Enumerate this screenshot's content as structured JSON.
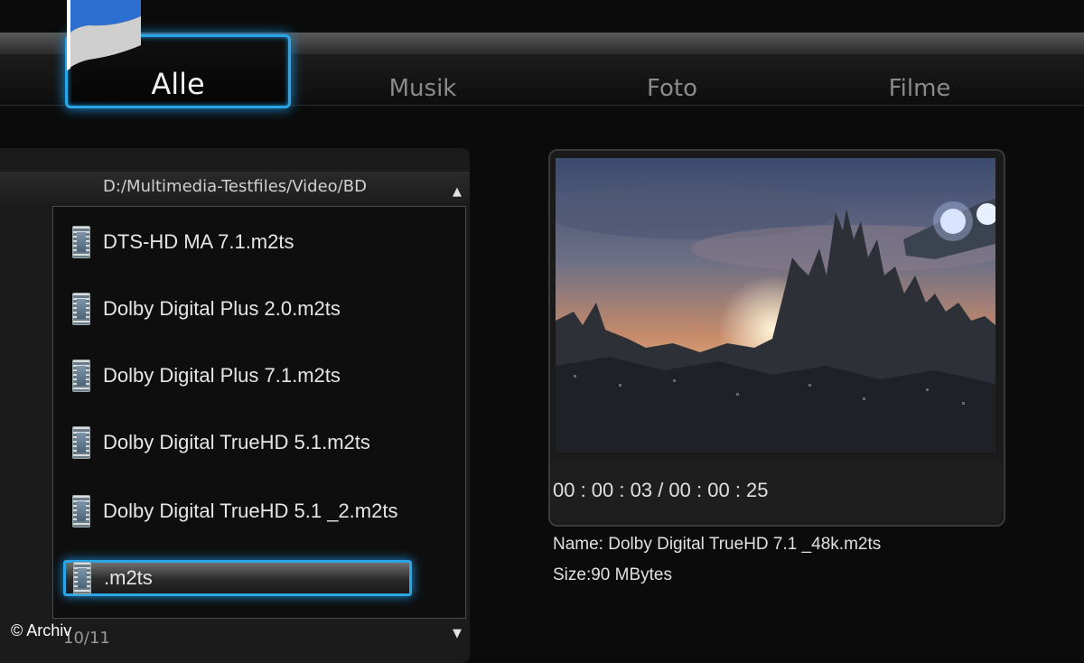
{
  "tabs": [
    {
      "label": "Alle",
      "active": true
    },
    {
      "label": "Musik",
      "active": false
    },
    {
      "label": "Foto",
      "active": false
    },
    {
      "label": "Filme",
      "active": false
    }
  ],
  "browser": {
    "path": "D:/Multimedia-Testfiles/Video/BD",
    "scroll_up_glyph": "▲",
    "scroll_down_glyph": "▼",
    "files": [
      {
        "name": "DTS-HD MA 7.1.m2ts",
        "icon": "film-file-icon"
      },
      {
        "name": "Dolby Digital Plus 2.0.m2ts",
        "icon": "film-file-icon"
      },
      {
        "name": "Dolby Digital Plus 7.1.m2ts",
        "icon": "film-file-icon"
      },
      {
        "name": "Dolby Digital TrueHD 5.1.m2ts",
        "icon": "film-file-icon"
      },
      {
        "name": "Dolby Digital TrueHD 5.1 _2.m2ts",
        "icon": "film-file-icon"
      },
      {
        "name": ".m2ts",
        "icon": "film-file-icon",
        "selected": true
      }
    ],
    "counter": "10/11"
  },
  "preview": {
    "time": "00 : 00 : 03 / 00 : 00 : 25",
    "name_line": "Name: Dolby Digital TrueHD 7.1 _48k.m2ts",
    "size_line": "Size:90 MBytes"
  },
  "watermark": "© Archiv",
  "colors": {
    "accent": "#2aa6e6",
    "background": "#0b0b0b"
  }
}
